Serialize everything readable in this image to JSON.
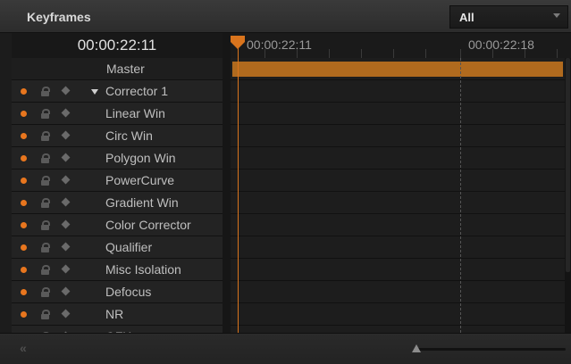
{
  "panel": {
    "title": "Keyframes",
    "filter": {
      "selected": "All",
      "caret_icon": "chevron-down-icon"
    }
  },
  "timecode": "00:00:22:11",
  "ruler": {
    "labels": [
      "00:00:22:11",
      "00:00:22:18"
    ]
  },
  "tracks": {
    "master": "Master",
    "corrector": "Corrector 1",
    "items": [
      "Linear Win",
      "Circ Win",
      "Polygon Win",
      "PowerCurve",
      "Gradient Win",
      "Color Corrector",
      "Qualifier",
      "Misc Isolation",
      "Defocus",
      "NR",
      "OFX"
    ]
  },
  "footer": {
    "collapse_label": "«"
  },
  "colors": {
    "accent": "#d9741d",
    "master_bar": "#b06a1e"
  },
  "zoom": 0
}
